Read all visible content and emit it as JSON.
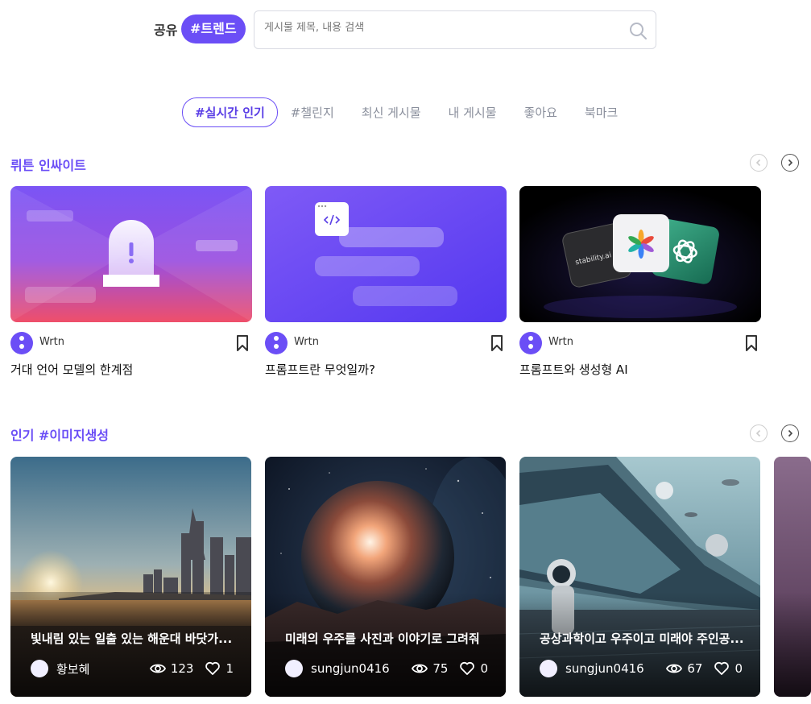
{
  "header": {
    "brand": "공유",
    "trend": "#트렌드",
    "search_placeholder": "게시물 제목, 내용 검색"
  },
  "tabs": [
    "#실시간 인기",
    "#챌린지",
    "최신 게시물",
    "내 게시물",
    "좋아요",
    "북마크"
  ],
  "section1": {
    "title": "뤼튼 인싸이트",
    "cards": [
      {
        "author": "Wrtn",
        "title": "거대 언어 모델의 한계점"
      },
      {
        "author": "Wrtn",
        "title": "프롬프트란 무엇일까?"
      },
      {
        "author": "Wrtn",
        "title": "프롬프트와 생성형 AI",
        "logo_text": "stability.ai"
      }
    ]
  },
  "section2": {
    "title": "인기 #이미지생성",
    "cards": [
      {
        "caption": "빛내림 있는 일출 있는 해운대 바닷가...",
        "user": "황보혜",
        "views": "123",
        "likes": "1"
      },
      {
        "caption": "미래의 우주를 사진과 이야기로 그려줘",
        "user": "sungjun0416",
        "views": "75",
        "likes": "0"
      },
      {
        "caption": "공상과학이고 우주이고 미래야 주인공...",
        "user": "sungjun0416",
        "views": "67",
        "likes": "0"
      }
    ]
  },
  "colors": {
    "accent": "#6b4ef6"
  }
}
